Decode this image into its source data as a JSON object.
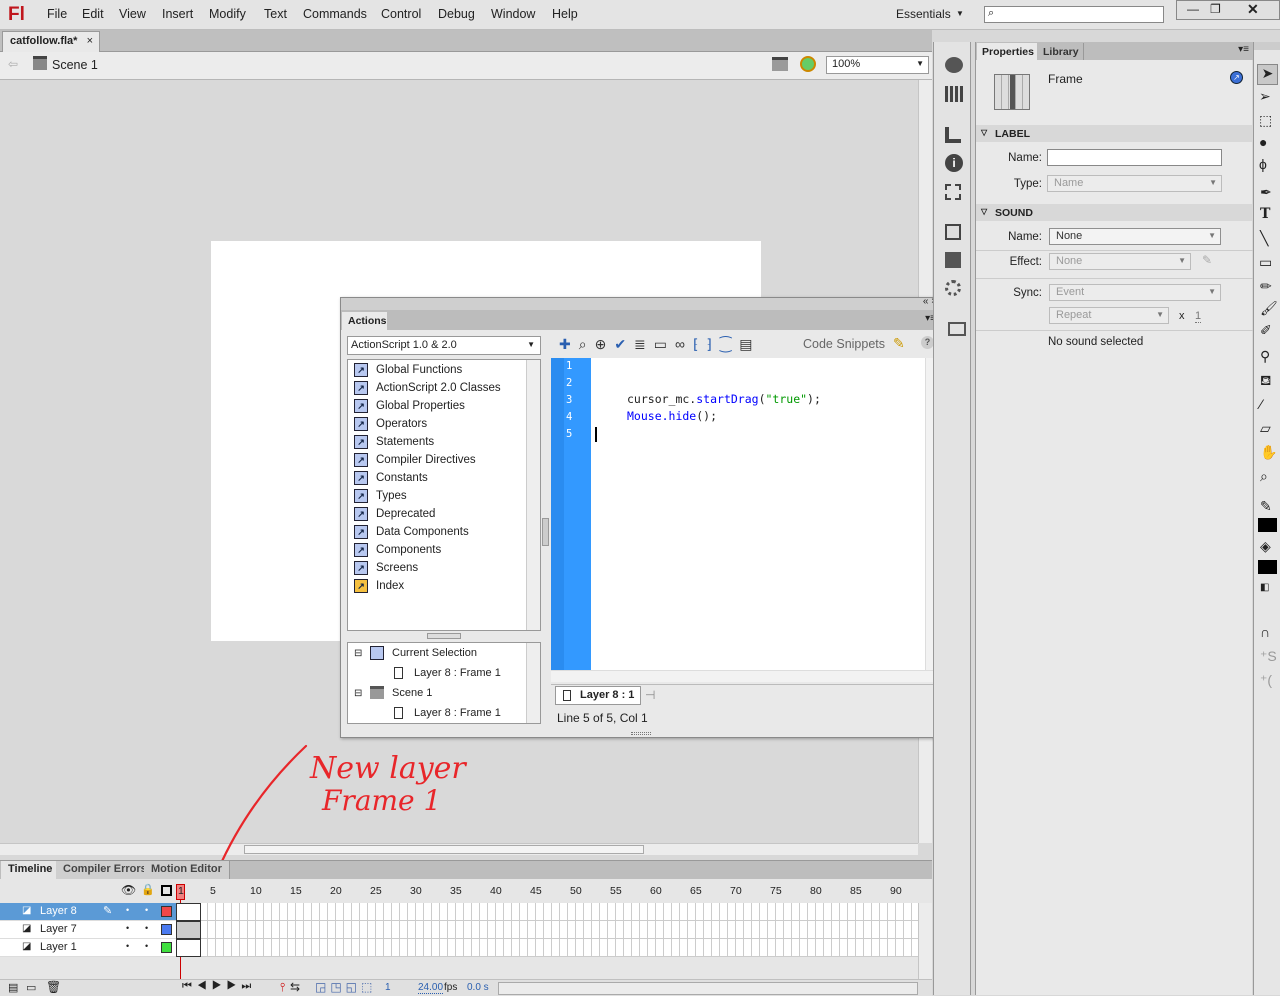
{
  "app": {
    "logo": "Fl",
    "workspace": "Essentials",
    "search_placeholder": ""
  },
  "menu": [
    "File",
    "Edit",
    "View",
    "Insert",
    "Modify",
    "Text",
    "Commands",
    "Control",
    "Debug",
    "Window",
    "Help"
  ],
  "document": {
    "tab": "catfollow.fla*",
    "scene": "Scene 1",
    "zoom": "100%"
  },
  "actions": {
    "title": "Actions",
    "version": "ActionScript 1.0 & 2.0",
    "code_snippets": "Code Snippets",
    "toolbox": [
      "Global Functions",
      "ActionScript 2.0 Classes",
      "Global Properties",
      "Operators",
      "Statements",
      "Compiler Directives",
      "Constants",
      "Types",
      "Deprecated",
      "Data Components",
      "Components",
      "Screens",
      "Index"
    ],
    "tree": [
      {
        "label": "Current Selection"
      },
      {
        "label": "Layer 8 : Frame 1"
      },
      {
        "label": "Scene 1"
      },
      {
        "label": "Layer 8 : Frame 1"
      }
    ],
    "line_numbers": [
      "1",
      "2",
      "3",
      "4",
      "5"
    ],
    "code": {
      "l3_obj": "cursor_mc.",
      "l3_method": "startDrag",
      "l3_open": "(",
      "l3_str": "\"true\"",
      "l3_close": ");",
      "l4_obj": "Mouse.hide",
      "l4_rest": "();"
    },
    "script_tab": "Layer 8 : 1",
    "status": "Line 5 of 5, Col 1"
  },
  "properties": {
    "tabs": [
      "Properties",
      "Library"
    ],
    "type": "Frame",
    "label_section": "LABEL",
    "name_label": "Name:",
    "name_value": "",
    "type_label": "Type:",
    "type_value": "Name",
    "sound_section": "SOUND",
    "sound_name_label": "Name:",
    "sound_name": "None",
    "effect_label": "Effect:",
    "effect": "None",
    "sync_label": "Sync:",
    "sync": "Event",
    "repeat": "Repeat",
    "repeat_x": "x",
    "repeat_count": "1",
    "no_sound": "No sound selected"
  },
  "timeline": {
    "tabs": [
      "Timeline",
      "Compiler Errors",
      "Motion Editor"
    ],
    "ticks": [
      "1",
      "5",
      "10",
      "15",
      "20",
      "25",
      "30",
      "35",
      "40",
      "45",
      "50",
      "55",
      "60",
      "65",
      "70",
      "75",
      "80",
      "85",
      "90"
    ],
    "layers": [
      {
        "name": "Layer 8",
        "color": "#f04848",
        "selected": true
      },
      {
        "name": "Layer 7",
        "color": "#4a7af0",
        "selected": false
      },
      {
        "name": "Layer 1",
        "color": "#40e040",
        "selected": false
      }
    ],
    "current_frame": "1",
    "fps": "24.00",
    "fps_unit": "fps",
    "time": "0.0 s"
  },
  "annotation": {
    "line1": "New layer",
    "line2": "Frame 1",
    "color": "#e8262a"
  }
}
